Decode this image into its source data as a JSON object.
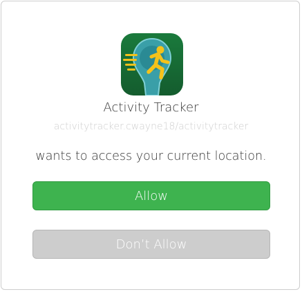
{
  "app": {
    "name": "Activity Tracker",
    "id": "activitytracker.cwayne18/activitytracker",
    "icon": "running-man-icon"
  },
  "prompt": {
    "message": "wants to access your current location."
  },
  "buttons": {
    "allow_label": "Allow",
    "deny_label": "Don’t Allow"
  },
  "colors": {
    "allow": "#3eb34f",
    "deny": "#cdcdcd",
    "icon_bg": "#1e6b3a",
    "icon_accent": "#f5c21a"
  }
}
